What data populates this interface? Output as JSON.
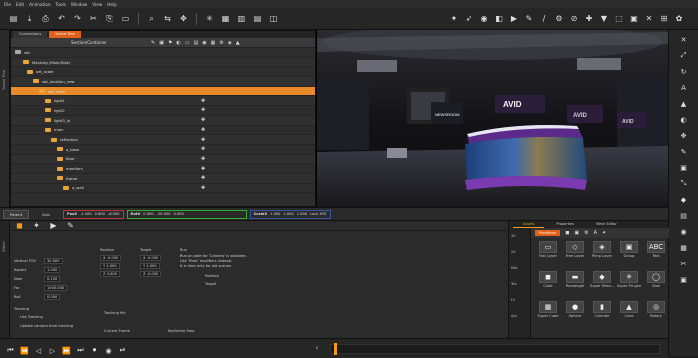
{
  "menu": [
    "File",
    "Edit",
    "Animation",
    "Tools",
    "Window",
    "View",
    "Help"
  ],
  "toolbar_left": [
    "new-icon",
    "open-icon",
    "save-icon",
    "undo-icon",
    "redo-icon",
    "cut-icon",
    "copy-icon",
    "paste-icon",
    "search-icon",
    "link-icon",
    "move-icon",
    "rotate-icon",
    "grid-icon",
    "layout-icon",
    "list-icon",
    "camera-icon"
  ],
  "toolbar_left_glyphs": [
    "▤",
    "⤓",
    "⎙",
    "↶",
    "↷",
    "✂",
    "⎘",
    "▭",
    "⌕",
    "⇆",
    "✥",
    "✳",
    "▦",
    "▥",
    "▤",
    "◫"
  ],
  "toolbar_right_glyphs": [
    "✦",
    "➶",
    "◉",
    "◧",
    "▶",
    "✎",
    "∕",
    "⚙",
    "⊘",
    "✚",
    "▼",
    "⬚",
    "▣",
    "✕",
    "⊞",
    "✿"
  ],
  "left_strip_label": "Scene Tree",
  "tree": {
    "tabs": [
      "Connections",
      "Scene Tree"
    ],
    "active_tab": "Scene Tree",
    "header_label": "Section/Container",
    "header_icons": [
      "✎",
      "▣",
      "⚑",
      "◐",
      "▭",
      "▤",
      "◉",
      "▦",
      "⚙",
      "◈",
      "▲"
    ],
    "rows": [
      {
        "name": "set",
        "indent": 4,
        "kind": "root"
      },
      {
        "name": "Masking (Main/Side)",
        "indent": 12,
        "kind": "item"
      },
      {
        "name": "set_scale",
        "indent": 16,
        "kind": "folder"
      },
      {
        "name": "set_location_new",
        "indent": 22,
        "kind": "folder"
      },
      {
        "name": "set_main",
        "indent": 28,
        "kind": "folder",
        "selected": true
      },
      {
        "name": "light1",
        "indent": 34,
        "kind": "folder"
      },
      {
        "name": "light2",
        "indent": 34,
        "kind": "folder"
      },
      {
        "name": "light3_io",
        "indent": 34,
        "kind": "folder"
      },
      {
        "name": "main",
        "indent": 34,
        "kind": "folder"
      },
      {
        "name": "reflection",
        "indent": 40,
        "kind": "folder"
      },
      {
        "name": "a_base",
        "indent": 46,
        "kind": "folder"
      },
      {
        "name": "floor",
        "indent": 46,
        "kind": "folder"
      },
      {
        "name": "monitors",
        "indent": 46,
        "kind": "folder"
      },
      {
        "name": "frame",
        "indent": 46,
        "kind": "folder"
      },
      {
        "name": "a_wall",
        "indent": 52,
        "kind": "folder"
      }
    ]
  },
  "viewport": {
    "logo": "AVID",
    "newsroom_text": "NEWSROOM"
  },
  "transform_bar": {
    "parent_label": "Parent",
    "axis_label": "Axis",
    "pos": {
      "label": "PosX",
      "x": "-1.400",
      "y": "0.800",
      "z": "-8.500"
    },
    "rot": {
      "label": "RotX",
      "x": "0.000",
      "y": "-20.000",
      "z": "0.000"
    },
    "scale": {
      "label": "ScaleX",
      "x": "1.000",
      "y": "1.000",
      "z": "1.000",
      "lock": "Lock XYZ"
    }
  },
  "props": {
    "strip_label": "Editor",
    "vertical_fov_label": "Vertical FOV",
    "vertical_fov": "30.000",
    "aspect_label": "Aspect",
    "aspect": "1.000",
    "near_label": "Near",
    "near": "0.100",
    "far_label": "Far",
    "far": "1000.000",
    "roll_label": "Roll",
    "roll": "0.000",
    "position_label": "Position",
    "target_label": "Target",
    "pos_x": "X -0.000",
    "pos_y": "Y 1.000",
    "pos_z": "Z 4.000",
    "tgt_x": "X -0.000",
    "tgt_y": "Y 1.000",
    "tgt_z": "Z -0.000",
    "run_label": "Run",
    "run_text1": "Run on  path for 'Camera' is obsolete.",
    "run_text2": "Use 'Pivot'  modifiers instead.",
    "run_text3": "It is here only for old scenes.",
    "position_btn": "Position",
    "target_btn": "Target",
    "tracking_label": "Tracking",
    "use_tracking": "Use Tracking",
    "update_camera": "Update camera from tracking",
    "tracking_file": "Tracking file",
    "current_frame": "Current Frame",
    "keyframe": "Keyframe Step"
  },
  "library": {
    "tabs": [
      "Assets",
      "Properties",
      "Mesh Editor"
    ],
    "active_tab": "Assets",
    "category": "Primitives",
    "side": [
      "3d",
      "2d",
      "Mat",
      "Tex",
      "Fx",
      "Svc"
    ],
    "items": [
      {
        "cap": "Flat Layer",
        "g": "▭"
      },
      {
        "cap": "Free Layer",
        "g": "◇"
      },
      {
        "cap": "Pimp Layer",
        "g": "◈"
      },
      {
        "cap": "Group",
        "g": "▣"
      },
      {
        "cap": "Text",
        "g": "ABC"
      },
      {
        "cap": "Cube",
        "g": "◼"
      },
      {
        "cap": "Rectangle",
        "g": "▬"
      },
      {
        "cap": "Super Tetra...",
        "g": "◆"
      },
      {
        "cap": "Super Pri-gon",
        "g": "✳"
      },
      {
        "cap": "Disk",
        "g": "◯"
      },
      {
        "cap": "Super Cube",
        "g": "▦"
      },
      {
        "cap": "Sphere",
        "g": "●"
      },
      {
        "cap": "Cylinder",
        "g": "▮"
      },
      {
        "cap": "Cone",
        "g": "▲"
      },
      {
        "cap": "Rotary",
        "g": "◎"
      }
    ]
  },
  "timeline": {
    "controls": [
      "⏮",
      "⏪",
      "◁",
      "▷",
      "⏩",
      "⏭",
      "⏺",
      "◉",
      "⏯"
    ],
    "frame": "0"
  },
  "right_icons": [
    "✕",
    "⤢",
    "↻",
    "A",
    "▲",
    "◐",
    "✥",
    "✎",
    "▣",
    "⤡",
    "◆",
    "▤",
    "◉",
    "▦",
    "✂",
    "▣"
  ]
}
